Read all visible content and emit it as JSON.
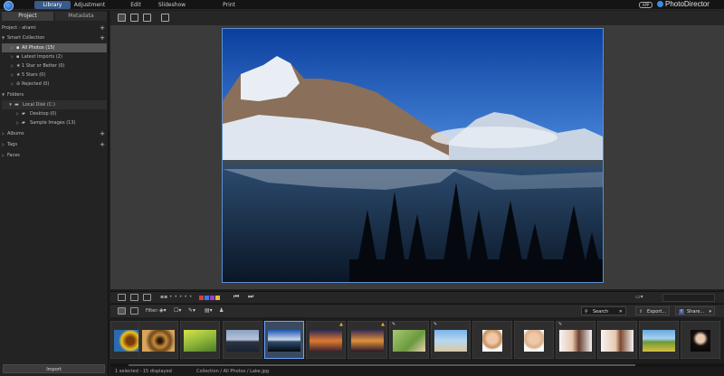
{
  "topbar": {
    "modes": [
      "Library",
      "Adjustment",
      "Edit",
      "Slideshow",
      "Print"
    ],
    "active_mode": "Library",
    "app_badge": "APP",
    "brand": "PhotoDirector",
    "window_controls": [
      "?",
      "—",
      "□",
      "✕"
    ]
  },
  "panel": {
    "tabs": [
      "Project",
      "Metadata"
    ],
    "project_name": "Project - ahami",
    "smart_collection": "Smart Collection",
    "smart_items": [
      "All Photos (15)",
      "Latest Imports (2)",
      "1 Star or Better (0)",
      "5 Stars (0)",
      "Rejected (0)"
    ],
    "folders": "Folders",
    "local_disk": "Local Disk (C:)",
    "desktop": "Desktop (0)",
    "sample_images": "Sample Images (13)",
    "albums": "Albums",
    "tags": "Tags",
    "faces": "Faces",
    "import_label": "Import"
  },
  "filterbar": {
    "filter_label": "Filter:",
    "search_placeholder": "Search",
    "export_label": "Export...",
    "share_label": "Share..."
  },
  "status": {
    "selection": "1 selected - 15 displayed",
    "path": "Collection / All Photos / Lake.jpg"
  },
  "colors": {
    "accent": "#6aa3ff",
    "label_colors": [
      "#e03a3a",
      "#3a7de0",
      "#a03ad0",
      "#e0c030"
    ]
  }
}
